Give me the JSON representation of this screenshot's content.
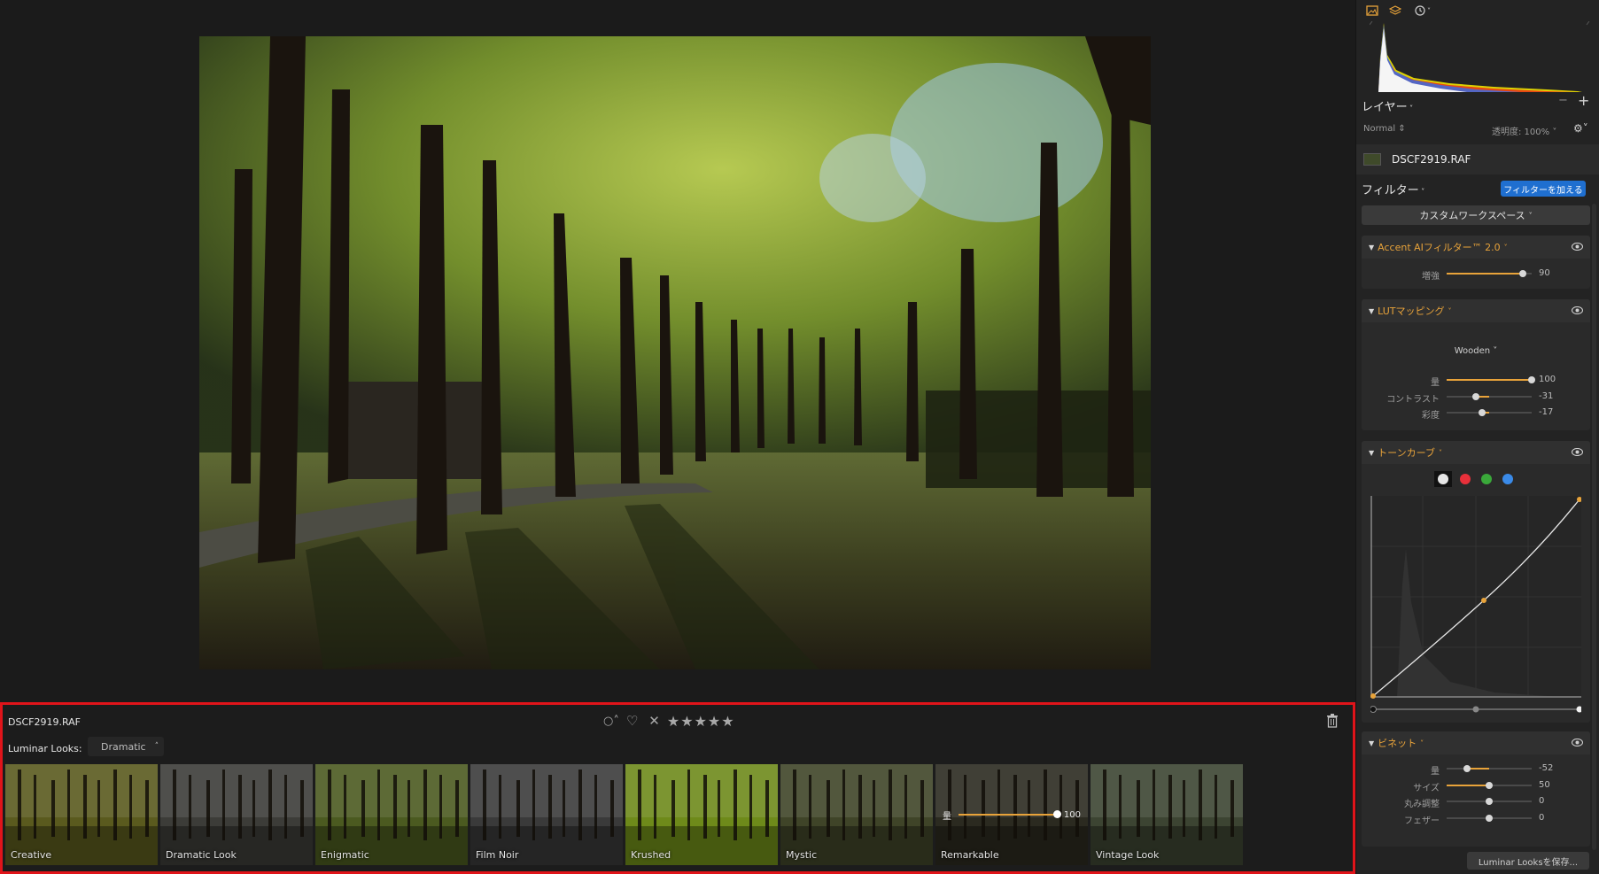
{
  "viewer": {
    "description_hidden": ""
  },
  "looks_panel": {
    "filename": "DSCF2919.RAF",
    "looks_label": "Luminar Looks:",
    "category": "Dramatic",
    "stars": "★★★★★",
    "thumbnails": [
      {
        "label": "Creative",
        "tone": "#5a5a1e"
      },
      {
        "label": "Dramatic Look",
        "tone": "#3c3c38"
      },
      {
        "label": "Enigmatic",
        "tone": "#4b5a20"
      },
      {
        "label": "Film Noir",
        "tone": "#3a3a3a"
      },
      {
        "label": "Krushed",
        "tone": "#6e8a1a"
      },
      {
        "label": "Mystic",
        "tone": "#3f4428"
      },
      {
        "label": "Remarkable",
        "tone": "#2b2a20",
        "selected": true,
        "amount_label": "量",
        "amount_value": "100",
        "amount_fraction": 1.0
      },
      {
        "label": "Vintage Look",
        "tone": "#3c4432"
      }
    ]
  },
  "sidebar": {
    "layers_title": "レイヤー",
    "blend_mode": "Normal",
    "opacity": "透明度: 100%",
    "layer_name": "DSCF2919.RAF",
    "filters_title": "フィルター",
    "add_filter": "フィルターを加える",
    "workspace": "カスタムワークスペース",
    "filters": [
      {
        "title": "Accent AIフィルター™ 2.0",
        "sliders": [
          {
            "label": "増強",
            "value": "90",
            "fraction": 0.9,
            "from_zero": true
          }
        ]
      },
      {
        "title": "LUTマッピング",
        "lut": "Wooden",
        "sliders": [
          {
            "label": "量",
            "value": "100",
            "fraction": 1.0,
            "from_zero": true
          },
          {
            "label": "コントラスト",
            "value": "-31",
            "fraction": 0.345,
            "from_zero": false
          },
          {
            "label": "彩度",
            "value": "-17",
            "fraction": 0.415,
            "from_zero": false
          }
        ]
      },
      {
        "title": "トーンカーブ",
        "sliders": []
      },
      {
        "title": "ビネット",
        "sliders": [
          {
            "label": "量",
            "value": "-52",
            "fraction": 0.24,
            "from_zero": false
          },
          {
            "label": "サイズ",
            "value": "50",
            "fraction": 0.5,
            "from_zero": true
          },
          {
            "label": "丸み調整",
            "value": "0",
            "fraction": 0.5,
            "from_zero": false
          },
          {
            "label": "フェザー",
            "value": "0",
            "fraction": 0.5,
            "from_zero": false
          }
        ]
      }
    ],
    "save_looks": "Luminar Looksを保存..."
  },
  "colors": {
    "accent": "#e8a33a",
    "selection": "#e0141a",
    "button": "#1f6fd0"
  }
}
